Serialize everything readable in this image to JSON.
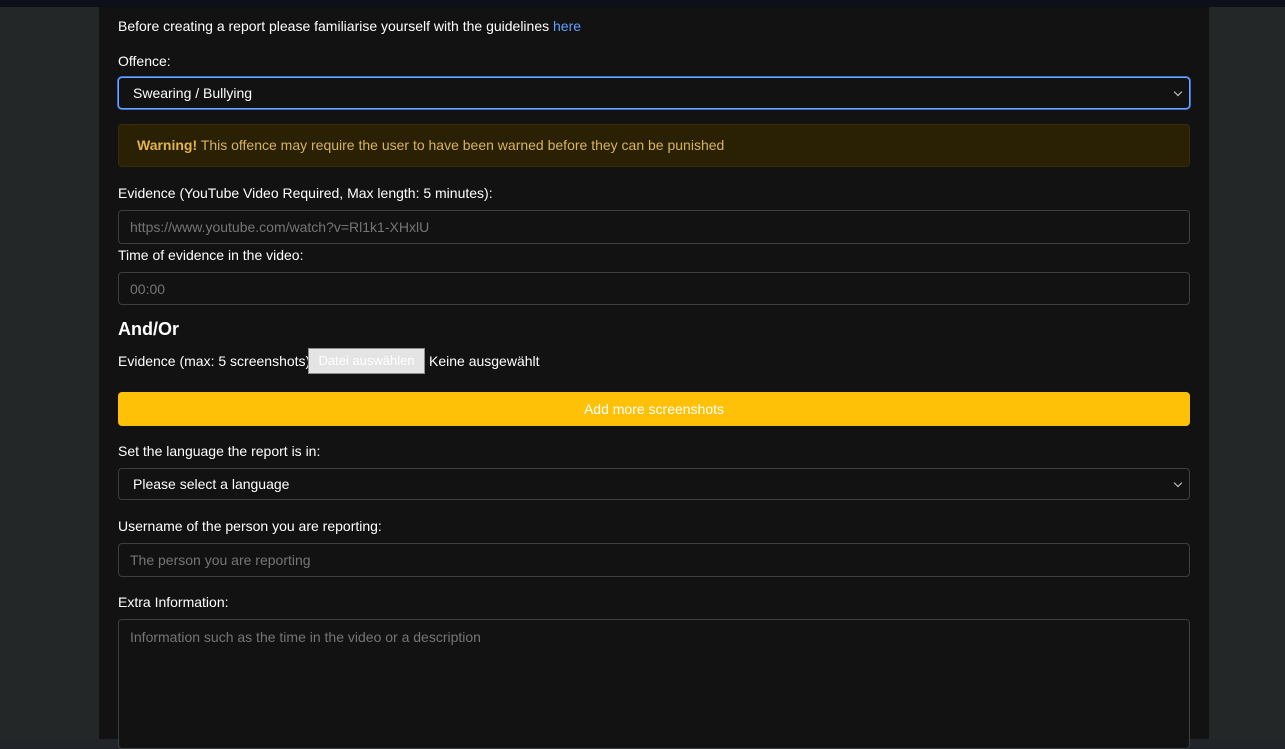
{
  "intro": {
    "text": "Before creating a report please familiarise yourself with the guidelines ",
    "link_label": "here"
  },
  "offence": {
    "label": "Offence:",
    "selected": "Swearing / Bullying"
  },
  "warning": {
    "strong": "Warning!",
    "text": " This offence may require the user to have been warned before they can be punished"
  },
  "evidence_video": {
    "label": "Evidence (YouTube Video Required, Max length: 5 minutes):",
    "placeholder": "https://www.youtube.com/watch?v=Rl1k1-XHxlU"
  },
  "evidence_time": {
    "label": "Time of evidence in the video:",
    "placeholder": "00:00"
  },
  "and_or": "And/Or",
  "screenshots": {
    "label": "Evidence (max: 5 screenshots):",
    "file_button": "Datei auswählen",
    "file_status": "Keine ausgewählt",
    "add_more_label": "Add more screenshots"
  },
  "language": {
    "label": "Set the language the report is in:",
    "selected": "Please select a language"
  },
  "username": {
    "label": "Username of the person you are reporting:",
    "placeholder": "The person you are reporting"
  },
  "extra": {
    "label": "Extra Information:",
    "placeholder": "Information such as the time in the video or a description"
  },
  "colors": {
    "accent_yellow": "#ffc107",
    "link_blue": "#5ea1ff",
    "warning_text": "#d7b35c",
    "panel_bg": "#121212",
    "page_bg": "#232728"
  }
}
